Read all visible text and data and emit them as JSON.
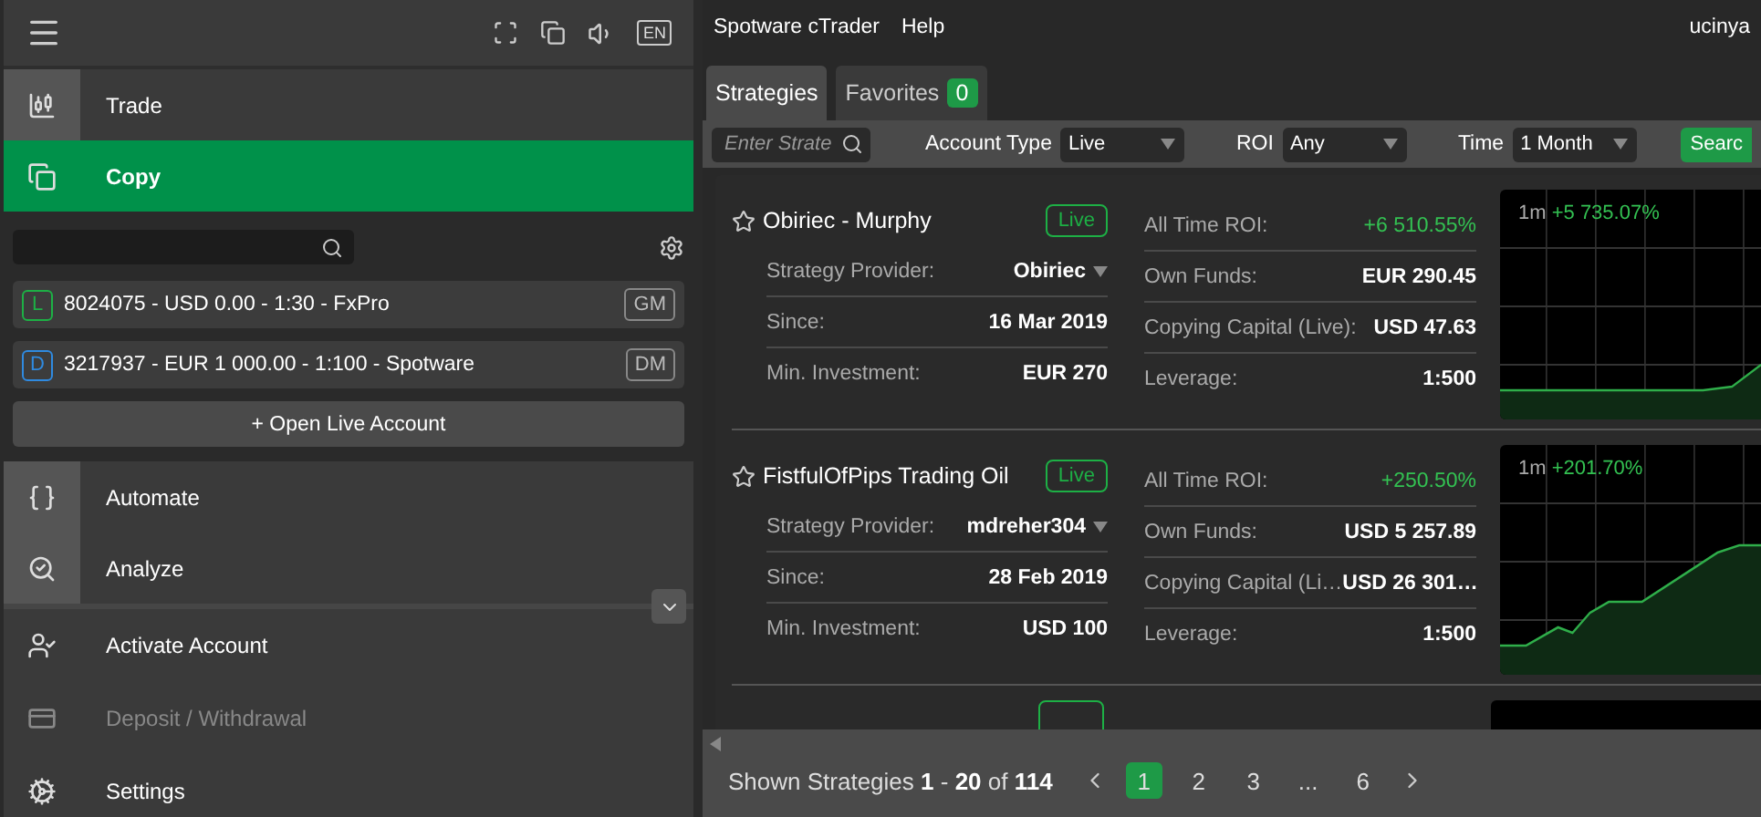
{
  "toolbar": {
    "language": "EN"
  },
  "nav_top": [
    {
      "label": "Trade",
      "selected": false,
      "icon_tile": true
    },
    {
      "label": "Copy",
      "selected": true,
      "icon_tile": false
    }
  ],
  "copy_panel": {
    "accounts": [
      {
        "letter": "L",
        "color": "#1db045",
        "label": "8024075 - USD 0.00 - 1:30 - FxPro",
        "tag": "GM"
      },
      {
        "letter": "D",
        "color": "#2f8ae0",
        "label": "3217937 - EUR 1 000.00 - 1:100 - Spotware",
        "tag": "DM"
      }
    ],
    "open_button": "+ Open Live Account"
  },
  "nav_mid": [
    {
      "label": "Automate",
      "selected": false,
      "icon_tile": true
    },
    {
      "label": "Analyze",
      "selected": false,
      "icon_tile": true
    }
  ],
  "nav_bottom": [
    {
      "label": "Activate Account",
      "disabled": false
    },
    {
      "label": "Deposit / Withdrawal",
      "disabled": true
    },
    {
      "label": "Settings",
      "disabled": false
    }
  ],
  "header": {
    "menu": [
      "Spotware cTrader",
      "Help"
    ],
    "user": "ucinya"
  },
  "tabs": [
    {
      "label": "Strategies",
      "selected": true
    },
    {
      "label": "Favorites",
      "count": "0",
      "selected": false
    }
  ],
  "filters": {
    "search_placeholder": "Enter Strate",
    "selects": [
      {
        "label": "Account Type",
        "value": "Live"
      },
      {
        "label": "ROI",
        "value": "Any"
      },
      {
        "label": "Time",
        "value": "1 Month"
      }
    ],
    "search_button": "Searc"
  },
  "strategies": [
    {
      "name": "Obiriec - Murphy",
      "badge": "Live",
      "favorite": false,
      "left": [
        {
          "label": "Strategy Provider:",
          "value": "Obiriec",
          "kind": "dropdown"
        },
        {
          "label": "Since:",
          "value": "16 Mar 2019",
          "kind": "text"
        },
        {
          "label": "Min. Investment:",
          "value": "EUR 270",
          "kind": "text"
        }
      ],
      "right": [
        {
          "label": "All Time ROI:",
          "value": "+6 510.55%",
          "kind": "positive"
        },
        {
          "label": "Own Funds:",
          "value": "EUR 290.45",
          "kind": "text"
        },
        {
          "label": "Copying Capital (Live):",
          "value": "USD 47.63",
          "kind": "text"
        },
        {
          "label": "Leverage:",
          "value": "1:500",
          "kind": "text"
        }
      ],
      "chart": {
        "period": "1m",
        "change": "+5 735.07%"
      }
    },
    {
      "name": "FistfulOfPips Trading Oil",
      "badge": "Live",
      "favorite": false,
      "left": [
        {
          "label": "Strategy Provider:",
          "value": "mdreher304",
          "kind": "dropdown"
        },
        {
          "label": "Since:",
          "value": "28 Feb 2019",
          "kind": "text"
        },
        {
          "label": "Min. Investment:",
          "value": "USD 100",
          "kind": "text"
        }
      ],
      "right": [
        {
          "label": "All Time ROI:",
          "value": "+250.50%",
          "kind": "positive"
        },
        {
          "label": "Own Funds:",
          "value": "USD 5 257.89",
          "kind": "text"
        },
        {
          "label": "Copying Capital (Li…",
          "value": "USD 26 301…",
          "kind": "text"
        },
        {
          "label": "Leverage:",
          "value": "1:500",
          "kind": "text"
        }
      ],
      "chart": {
        "period": "1m",
        "change": "+201.70%"
      }
    }
  ],
  "footer": {
    "shown": "Shown Strategies **1** - **20** of **114**",
    "pages": [
      {
        "label": "1",
        "selected": true
      },
      {
        "label": "2",
        "selected": false
      },
      {
        "label": "3",
        "selected": false
      },
      {
        "label": "...",
        "selected": false
      },
      {
        "label": "6",
        "selected": false
      }
    ]
  }
}
